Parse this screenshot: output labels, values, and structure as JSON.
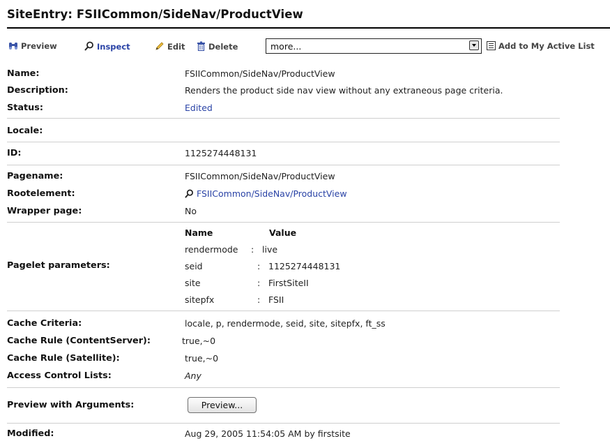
{
  "page": {
    "title": "SiteEntry: FSIICommon/SideNav/ProductView"
  },
  "toolbar": {
    "preview_label": "Preview",
    "inspect_label": "Inspect",
    "edit_label": "Edit",
    "delete_label": "Delete",
    "select_value": "more...",
    "add_list_label": "Add to My Active List"
  },
  "fields": {
    "name_label": "Name:",
    "name_value": "FSIICommon/SideNav/ProductView",
    "description_label": "Description:",
    "description_value": "Renders the product side nav view without any extraneous page criteria.",
    "status_label": "Status:",
    "status_value": "Edited",
    "locale_label": "Locale:",
    "id_label": "ID:",
    "id_value": "1125274448131",
    "pagename_label": "Pagename:",
    "pagename_value": "FSIICommon/SideNav/ProductView",
    "rootelement_label": "Rootelement:",
    "rootelement_value": "FSIICommon/SideNav/ProductView",
    "wrapper_label": "Wrapper page:",
    "wrapper_value": "No",
    "pagelet_label": "Pagelet parameters:",
    "cache_criteria_label": "Cache Criteria:",
    "cache_criteria_value": "locale, p, rendermode, seid, site, sitepfx, ft_ss",
    "cache_rule_cs_label": "Cache Rule (ContentServer):",
    "cache_rule_cs_value": "true,~0",
    "cache_rule_sat_label": "Cache Rule (Satellite):",
    "cache_rule_sat_value": "true,~0",
    "acl_label": "Access Control Lists:",
    "acl_value": "Any",
    "preview_args_label": "Preview with Arguments:",
    "preview_button_label": "Preview...",
    "modified_label": "Modified:",
    "modified_value": "Aug 29, 2005 11:54:05 AM by firstsite"
  },
  "pagelet_params": {
    "header_name": "Name",
    "header_value": "Value",
    "rows": [
      {
        "name": "rendermode",
        "sep": ":",
        "value": "live"
      },
      {
        "name": "seid",
        "sep": ":",
        "value": "1125274448131"
      },
      {
        "name": "site",
        "sep": ":",
        "value": "FirstSiteII"
      },
      {
        "name": "sitepfx",
        "sep": ":",
        "value": "FSII"
      }
    ]
  },
  "colors": {
    "link": "#2a43a6",
    "rule": "#000000",
    "separator": "#cfcfcf"
  }
}
